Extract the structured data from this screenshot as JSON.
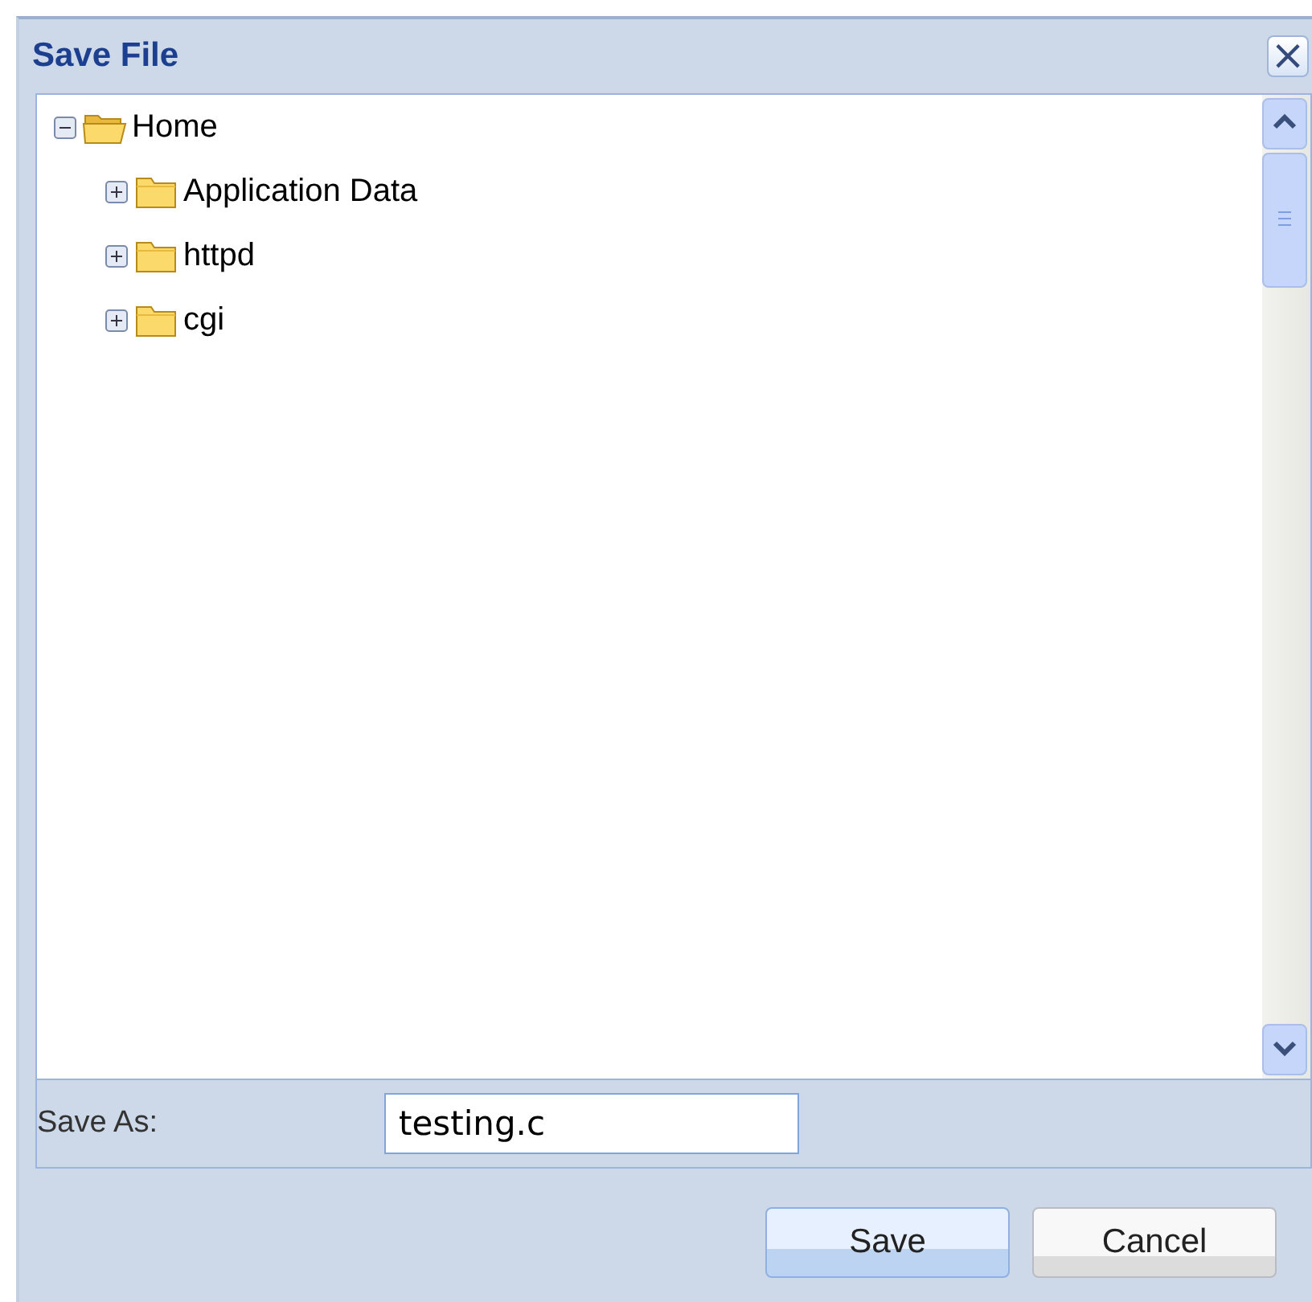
{
  "window": {
    "title": "Save File",
    "close": "×"
  },
  "tree": [
    {
      "label": "Home",
      "expanded": true,
      "children": [
        {
          "label": "Application Data",
          "expanded": false
        },
        {
          "label": "httpd",
          "expanded": false
        },
        {
          "label": "cgi",
          "expanded": false
        }
      ]
    }
  ],
  "save_as": {
    "label": "Save As:",
    "value": "testing.c"
  },
  "buttons": [
    {
      "label": "Save",
      "focused": true
    },
    {
      "label": "Cancel",
      "focused": false
    }
  ]
}
